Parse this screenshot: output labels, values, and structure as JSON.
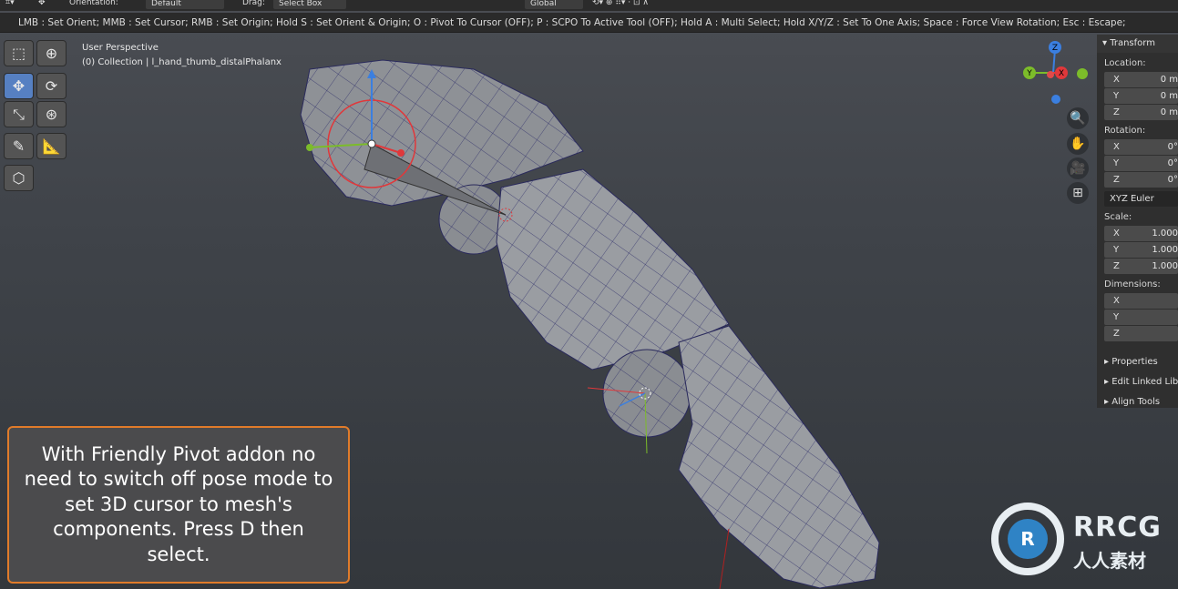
{
  "header": {
    "orientation_label": "Orientation:",
    "orientation_value": "Default",
    "drag_label": "Drag:",
    "drag_value": "Select Box",
    "transform_space": "Global"
  },
  "hint_bar": "LMB : Set Orient;  MMB : Set Cursor;  RMB : Set Origin;  Hold S : Set Orient & Origin;   O : Pivot To Cursor (OFF);   P : SCPO To Active Tool (OFF);  Hold A : Multi Select;  Hold X/Y/Z : Set To One Axis;  Space : Force View Rotation;  Esc : Escape;",
  "viewport": {
    "view_name": "User Perspective",
    "collection": "(0) Collection | l_hand_thumb_distalPhalanx"
  },
  "toolbar": {
    "tools": [
      "select-box",
      "cursor",
      "move",
      "rotate",
      "scale",
      "transform",
      "annotate",
      "measure",
      "add-cube"
    ],
    "active": "move"
  },
  "gizmo": {
    "z": "Z",
    "y": "Y",
    "x": "X"
  },
  "npanel": {
    "transform_title": "Transform",
    "location_label": "Location:",
    "location": [
      {
        "axis": "X",
        "value": "0 m"
      },
      {
        "axis": "Y",
        "value": "0 m"
      },
      {
        "axis": "Z",
        "value": "0 m"
      }
    ],
    "rotation_label": "Rotation:",
    "rotation": [
      {
        "axis": "X",
        "value": "0°"
      },
      {
        "axis": "Y",
        "value": "0°"
      },
      {
        "axis": "Z",
        "value": "0°"
      }
    ],
    "rotation_mode": "XYZ Euler",
    "scale_label": "Scale:",
    "scale": [
      {
        "axis": "X",
        "value": "1.000"
      },
      {
        "axis": "Y",
        "value": "1.000"
      },
      {
        "axis": "Z",
        "value": "1.000"
      }
    ],
    "dimensions_label": "Dimensions:",
    "dimensions": [
      {
        "axis": "X",
        "value": ""
      },
      {
        "axis": "Y",
        "value": ""
      },
      {
        "axis": "Z",
        "value": ""
      }
    ],
    "properties": "Properties",
    "edit_linked": "Edit Linked Library",
    "align_tools": "Align Tools"
  },
  "caption": "With Friendly Pivot addon no need to switch off pose mode to set 3D cursor to mesh's components. Press D then select.",
  "watermark": {
    "brand": "RRCG",
    "chinese": "人人素材"
  },
  "colors": {
    "accent_active": "#5680c2",
    "caption_border": "#e07b2a",
    "x_axis": "#e0383b",
    "y_axis": "#7cbc2a",
    "z_axis": "#3b7fe0"
  }
}
